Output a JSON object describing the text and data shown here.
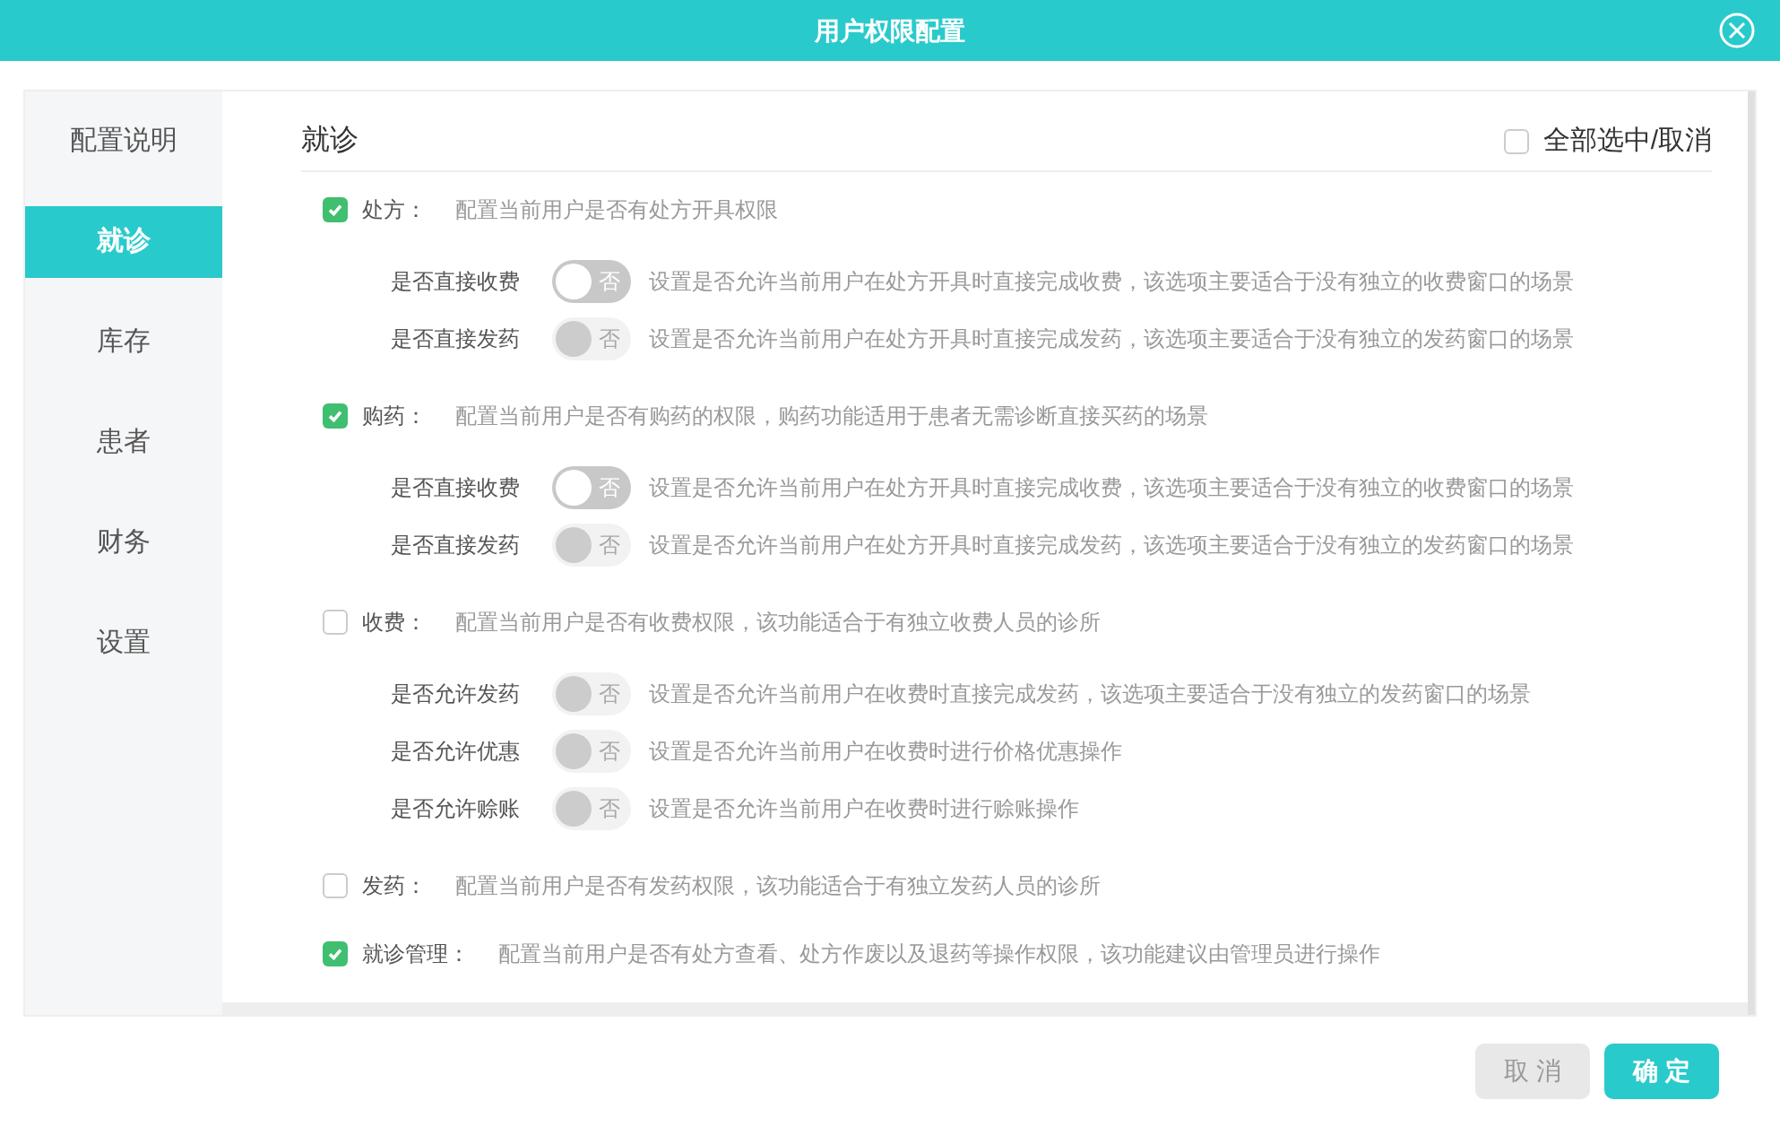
{
  "window": {
    "title": "用户权限配置"
  },
  "sidebar": {
    "items": [
      {
        "label": "配置说明",
        "selected": false
      },
      {
        "label": "就诊",
        "selected": true
      },
      {
        "label": "库存",
        "selected": false
      },
      {
        "label": "患者",
        "selected": false
      },
      {
        "label": "财务",
        "selected": false
      },
      {
        "label": "设置",
        "selected": false
      }
    ]
  },
  "content": {
    "title": "就诊",
    "select_all": {
      "label": "全部选中/取消",
      "checked": false
    },
    "sections": [
      {
        "label": "处方：",
        "checked": true,
        "description": "配置当前用户是否有处方开具权限",
        "options": [
          {
            "label": "是否直接收费",
            "on": false,
            "disabled": false,
            "state_text": "否",
            "description": "设置是否允许当前用户在处方开具时直接完成收费，该选项主要适合于没有独立的收费窗口的场景"
          },
          {
            "label": "是否直接发药",
            "on": false,
            "disabled": true,
            "state_text": "否",
            "description": "设置是否允许当前用户在处方开具时直接完成发药，该选项主要适合于没有独立的发药窗口的场景"
          }
        ]
      },
      {
        "label": "购药：",
        "checked": true,
        "description": "配置当前用户是否有购药的权限，购药功能适用于患者无需诊断直接买药的场景",
        "options": [
          {
            "label": "是否直接收费",
            "on": false,
            "disabled": false,
            "state_text": "否",
            "description": "设置是否允许当前用户在处方开具时直接完成收费，该选项主要适合于没有独立的收费窗口的场景"
          },
          {
            "label": "是否直接发药",
            "on": false,
            "disabled": true,
            "state_text": "否",
            "description": "设置是否允许当前用户在处方开具时直接完成发药，该选项主要适合于没有独立的发药窗口的场景"
          }
        ]
      },
      {
        "label": "收费：",
        "checked": false,
        "description": "配置当前用户是否有收费权限，该功能适合于有独立收费人员的诊所",
        "options": [
          {
            "label": "是否允许发药",
            "on": false,
            "disabled": true,
            "state_text": "否",
            "description": "设置是否允许当前用户在收费时直接完成发药，该选项主要适合于没有独立的发药窗口的场景"
          },
          {
            "label": "是否允许优惠",
            "on": false,
            "disabled": true,
            "state_text": "否",
            "description": "设置是否允许当前用户在收费时进行价格优惠操作"
          },
          {
            "label": "是否允许赊账",
            "on": false,
            "disabled": true,
            "state_text": "否",
            "description": "设置是否允许当前用户在收费时进行赊账操作"
          }
        ]
      },
      {
        "label": "发药：",
        "checked": false,
        "description": "配置当前用户是否有发药权限，该功能适合于有独立发药人员的诊所"
      },
      {
        "label": "就诊管理：",
        "checked": true,
        "description": "配置当前用户是否有处方查看、处方作废以及退药等操作权限，该功能建议由管理员进行操作"
      }
    ]
  },
  "buttons": [
    {
      "label": "取 消",
      "kind": "cancel"
    },
    {
      "label": "确 定",
      "kind": "confirm"
    }
  ]
}
